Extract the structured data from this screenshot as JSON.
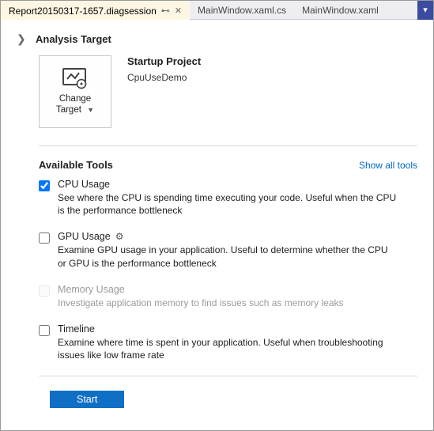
{
  "tabs": [
    {
      "label": "Report20150317-1657.diagsession",
      "active": true
    },
    {
      "label": "MainWindow.xaml.cs",
      "active": false
    },
    {
      "label": "MainWindow.xaml",
      "active": false
    }
  ],
  "analysis": {
    "heading": "Analysis Target",
    "tile_line1": "Change",
    "tile_line2": "Target",
    "project_title": "Startup Project",
    "project_name": "CpuUseDemo"
  },
  "tools_heading": "Available Tools",
  "show_all": "Show all tools",
  "tools": [
    {
      "name": "CPU Usage",
      "desc": "See where the CPU is spending time executing your code. Useful when the CPU is the performance bottleneck",
      "checked": true,
      "disabled": false,
      "gear": false
    },
    {
      "name": "GPU Usage",
      "desc": "Examine GPU usage in your application. Useful to determine whether the CPU or GPU is the performance bottleneck",
      "checked": false,
      "disabled": false,
      "gear": true
    },
    {
      "name": "Memory Usage",
      "desc": "Investigate application memory to find issues such as memory leaks",
      "checked": false,
      "disabled": true,
      "gear": false
    },
    {
      "name": "Timeline",
      "desc": "Examine where time is spent in your application. Useful when troubleshooting issues like low frame rate",
      "checked": false,
      "disabled": false,
      "gear": false
    }
  ],
  "start_label": "Start"
}
